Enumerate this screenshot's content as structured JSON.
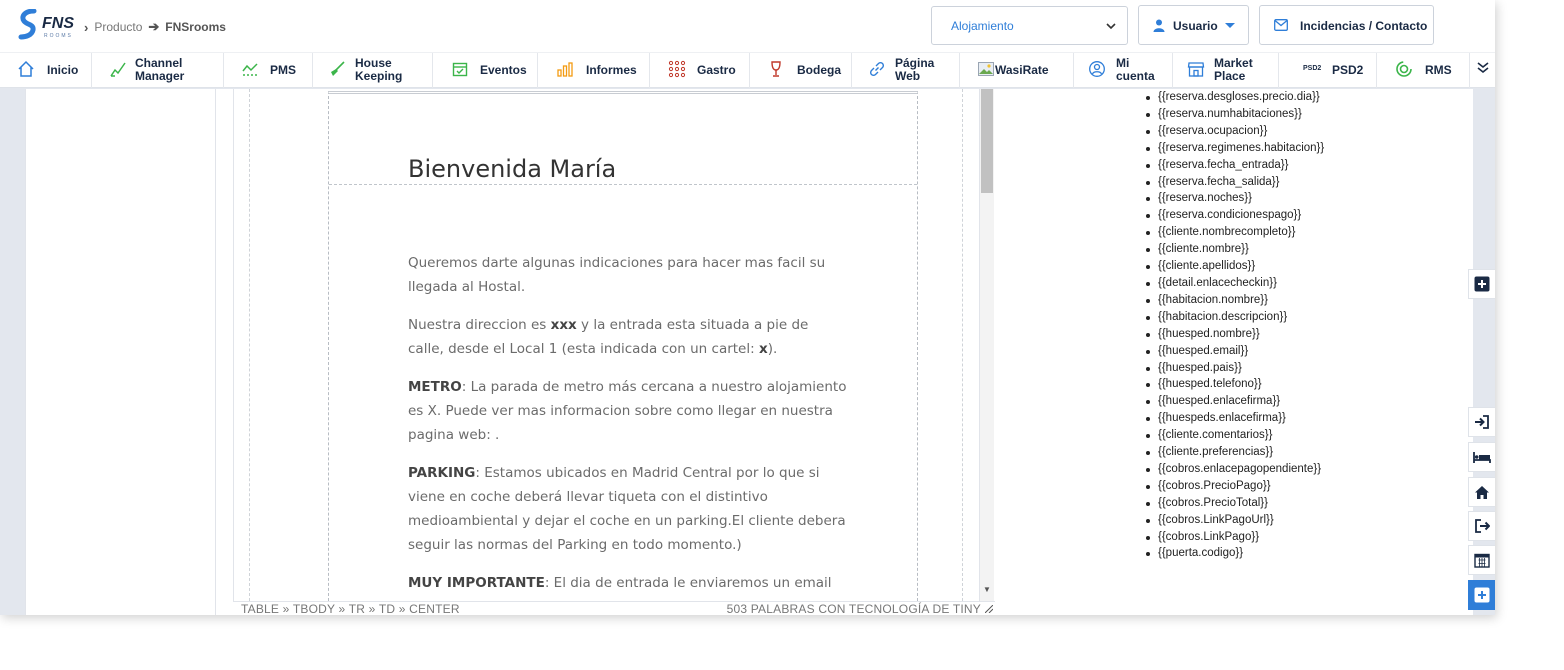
{
  "header": {
    "logo_text": "FNS",
    "logo_sub": "ROOMS",
    "breadcrumb": {
      "item1": "Producto",
      "item2": "FNSrooms"
    },
    "select_value": "Alojamiento",
    "user_label": "Usuario",
    "contact_label": "Incidencias / Contacto"
  },
  "nav": {
    "items": [
      {
        "label": "Inicio",
        "icon": "home-icon"
      },
      {
        "label1": "Channel",
        "label2": "Manager",
        "icon": "channel-icon"
      },
      {
        "label": "PMS",
        "icon": "pms-chart-icon"
      },
      {
        "label1": "House",
        "label2": "Keeping",
        "icon": "broom-icon"
      },
      {
        "label": "Eventos",
        "icon": "calendar-check-icon"
      },
      {
        "label": "Informes",
        "icon": "bar-chart-icon"
      },
      {
        "label": "Gastro",
        "icon": "grid-dots-icon"
      },
      {
        "label": "Bodega",
        "icon": "wine-glass-icon"
      },
      {
        "label1": "Página",
        "label2": "Web",
        "icon": "link-icon"
      },
      {
        "label": "WasiRate",
        "icon": "image-icon"
      },
      {
        "label1": "Mi",
        "label2": "cuenta",
        "icon": "user-circle-icon"
      },
      {
        "label1": "Market",
        "label2": "Place",
        "icon": "store-icon"
      },
      {
        "label": "PSD2",
        "icon": "psd2-icon",
        "icon_text": "PSD2"
      },
      {
        "label": "RMS",
        "icon": "rms-icon"
      }
    ]
  },
  "editor": {
    "title": "Bienvenida María",
    "p1": "Queremos darte algunas indicaciones para hacer mas facil su llegada al Hostal.",
    "p2_a": "Nuestra direccion es ",
    "p2_b": "xxx",
    "p2_c": " y la entrada esta situada a pie de calle, desde el Local 1 (esta indicada con un cartel: ",
    "p2_d": "x",
    "p2_e": ").",
    "p3_a": "METRO",
    "p3_b": ": La parada de metro más cercana a nuestro alojamiento es X. Puede ver mas informacion sobre como llegar en nuestra pagina web: .",
    "p4_a": "PARKING",
    "p4_b": ": Estamos ubicados en Madrid Central por lo que si viene en coche deberá llevar tiqueta con el distintivo medioambiental y dejar el coche en un parking.El cliente debera seguir las normas del Parking en todo momento.)",
    "p5_a": "MUY IMPORTANTE",
    "p5_b": ": El dia de entrada le enviaremos un email con las instrucciones de acceso, para ello desde ahora tienes disponible el",
    "status_path": "TABLE » TBODY » TR » TD » CENTER",
    "status_right": "503 PALABRAS  CON TECNOLOGÍA DE TINY"
  },
  "variables": [
    "{{reserva.desgloses.precio.dia}}",
    "{{reserva.numhabitaciones}}",
    "{{reserva.ocupacion}}",
    "{{reserva.regimenes.habitacion}}",
    "{{reserva.fecha_entrada}}",
    "{{reserva.fecha_salida}}",
    "{{reserva.noches}}",
    "{{reserva.condicionespago}}",
    "{{cliente.nombrecompleto}}",
    "{{cliente.nombre}}",
    "{{cliente.apellidos}}",
    "{{detail.enlacecheckin}}",
    "{{habitacion.nombre}}",
    "{{habitacion.descripcion}}",
    "{{huesped.nombre}}",
    "{{huesped.email}}",
    "{{huesped.pais}}",
    "{{huesped.telefono}}",
    "{{huesped.enlacefirma}}",
    "{{huespeds.enlacefirma}}",
    "{{cliente.comentarios}}",
    "{{cliente.preferencias}}",
    "{{cobros.enlacepagopendiente}}",
    "{{cobros.PrecioPago}}",
    "{{cobros.PrecioTotal}}",
    "{{cobros.LinkPagoUrl}}",
    "{{cobros.LinkPago}}",
    "{{puerta.codigo}}"
  ],
  "side_buttons": [
    "plus-square-icon",
    "sign-in-icon",
    "bed-icon",
    "house-icon",
    "sign-out-icon",
    "calendar-icon",
    "plus-square-icon"
  ],
  "colors": {
    "accent": "#2f7ed8",
    "nav_green": "#3bb54a",
    "logo_blue": "#2f7ed8",
    "text_dark": "#1a2a44"
  }
}
